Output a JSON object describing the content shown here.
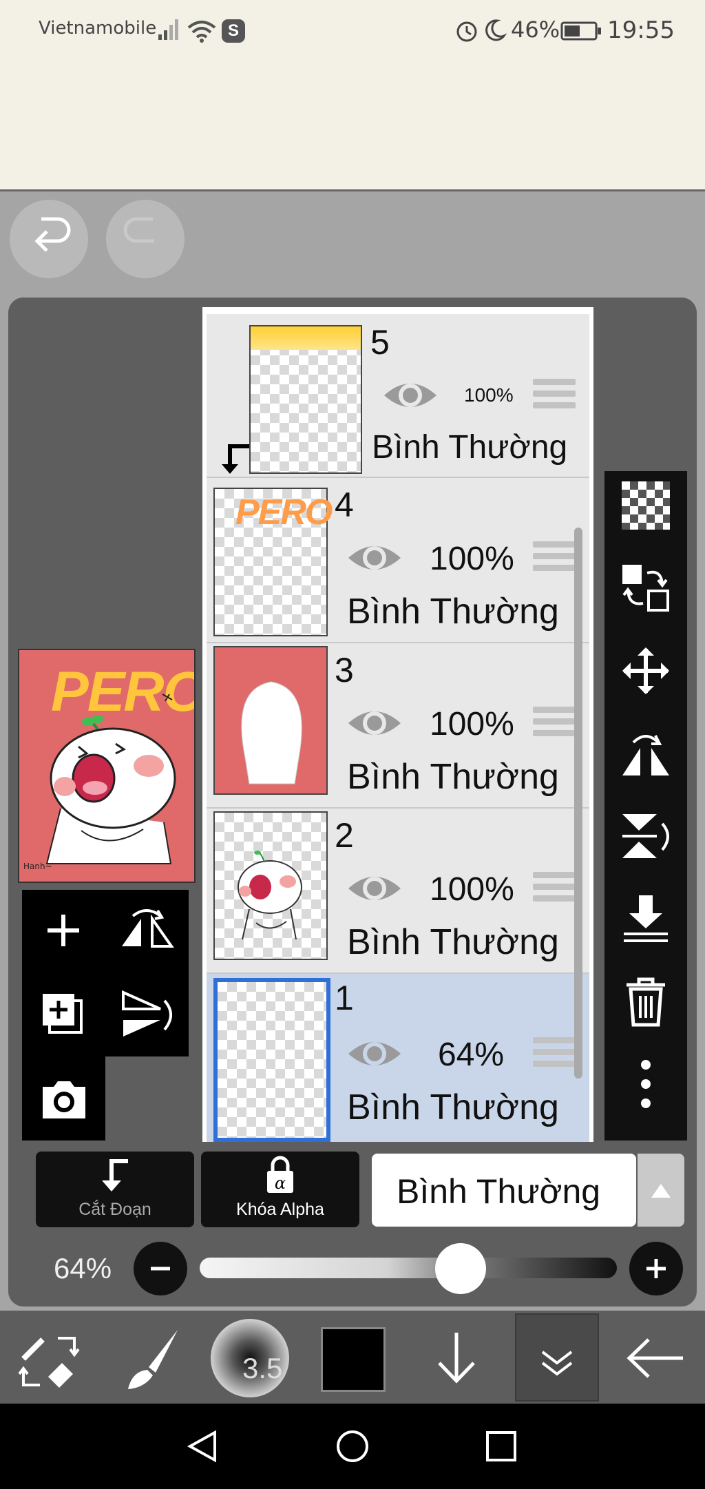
{
  "status_bar": {
    "carrier": "Vietnamobile",
    "battery": "46%",
    "time": "19:55"
  },
  "layers": [
    {
      "number": "5",
      "opacity": "100%",
      "mode": "Bình Thường",
      "selected": false,
      "clipped": true
    },
    {
      "number": "4",
      "opacity": "100%",
      "mode": "Bình Thường",
      "selected": false,
      "thumb_text": "PERO"
    },
    {
      "number": "3",
      "opacity": "100%",
      "mode": "Bình Thường",
      "selected": false
    },
    {
      "number": "2",
      "opacity": "100%",
      "mode": "Bình Thường",
      "selected": false
    },
    {
      "number": "1",
      "opacity": "64%",
      "mode": "Bình Thường",
      "selected": true
    }
  ],
  "preview": {
    "text": "PERO"
  },
  "bottom_controls": {
    "clip_label": "Cắt Đoạn",
    "alpha_lock_label": "Khóa Alpha",
    "blend_mode": "Bình Thường"
  },
  "opacity": {
    "label": "64%",
    "value": 0.64
  },
  "toolbar": {
    "brush_size": "3.5",
    "color": "#000000"
  },
  "colors": {
    "selected_layer_bg": "#c9d6ea",
    "selected_border": "#2f6fd6",
    "preview_bg": "#e06a6a"
  }
}
